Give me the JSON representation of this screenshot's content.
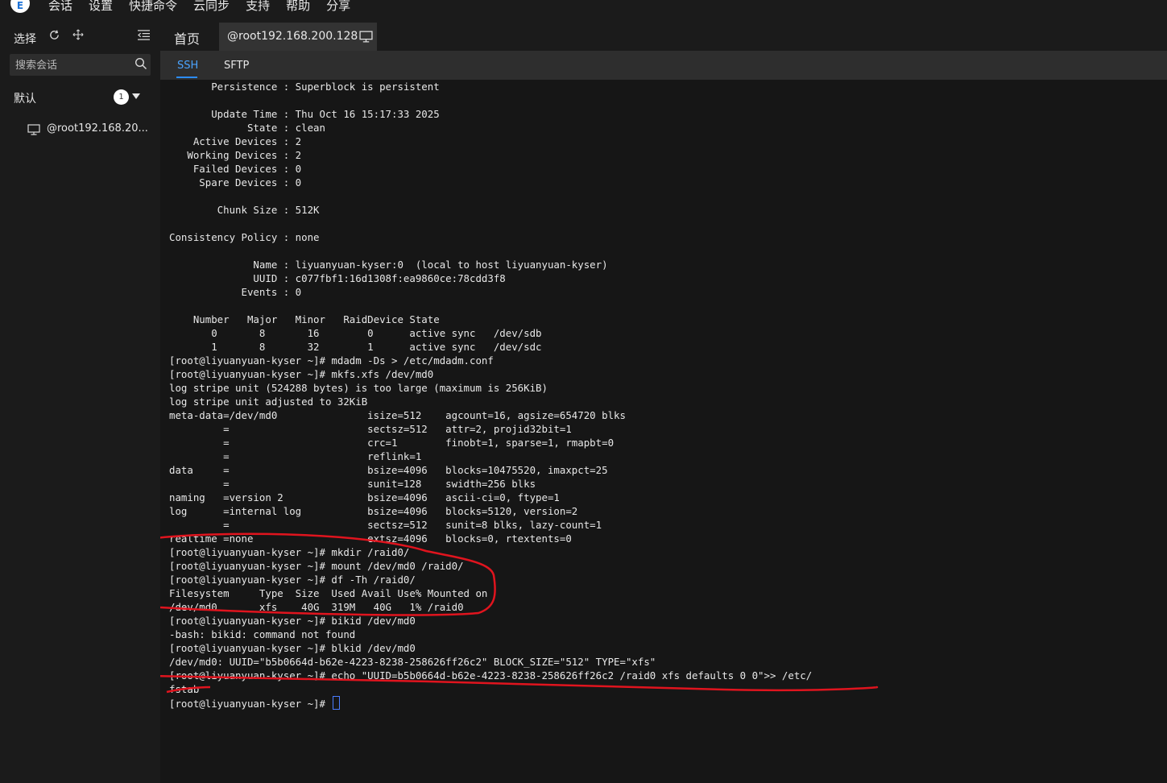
{
  "menubar": {
    "logo_text": "E",
    "items": [
      "会话",
      "设置",
      "快捷命令",
      "云同步",
      "支持",
      "帮助",
      "分享"
    ]
  },
  "sidebar": {
    "select_label": "选择",
    "search_placeholder": "搜索会话",
    "group": {
      "name": "默认",
      "count": "1"
    },
    "sessions": [
      "@root192.168.20..."
    ]
  },
  "tabs": {
    "home": "首页",
    "active": "@root192.168.200.128"
  },
  "subtabs": [
    "SSH",
    "SFTP"
  ],
  "terminal": {
    "lines": [
      "       Persistence : Superblock is persistent",
      "",
      "       Update Time : Thu Oct 16 15:17:33 2025",
      "             State : clean",
      "    Active Devices : 2",
      "   Working Devices : 2",
      "    Failed Devices : 0",
      "     Spare Devices : 0",
      "",
      "        Chunk Size : 512K",
      "",
      "Consistency Policy : none",
      "",
      "              Name : liyuanyuan-kyser:0  (local to host liyuanyuan-kyser)",
      "              UUID : c077fbf1:16d1308f:ea9860ce:78cdd3f8",
      "            Events : 0",
      "",
      "    Number   Major   Minor   RaidDevice State",
      "       0       8       16        0      active sync   /dev/sdb",
      "       1       8       32        1      active sync   /dev/sdc",
      "[root@liyuanyuan-kyser ~]# mdadm -Ds > /etc/mdadm.conf",
      "[root@liyuanyuan-kyser ~]# mkfs.xfs /dev/md0",
      "log stripe unit (524288 bytes) is too large (maximum is 256KiB)",
      "log stripe unit adjusted to 32KiB",
      "meta-data=/dev/md0               isize=512    agcount=16, agsize=654720 blks",
      "         =                       sectsz=512   attr=2, projid32bit=1",
      "         =                       crc=1        finobt=1, sparse=1, rmapbt=0",
      "         =                       reflink=1",
      "data     =                       bsize=4096   blocks=10475520, imaxpct=25",
      "         =                       sunit=128    swidth=256 blks",
      "naming   =version 2              bsize=4096   ascii-ci=0, ftype=1",
      "log      =internal log           bsize=4096   blocks=5120, version=2",
      "         =                       sectsz=512   sunit=8 blks, lazy-count=1",
      "realtime =none                   extsz=4096   blocks=0, rtextents=0",
      "[root@liyuanyuan-kyser ~]# mkdir /raid0/",
      "[root@liyuanyuan-kyser ~]# mount /dev/md0 /raid0/",
      "[root@liyuanyuan-kyser ~]# df -Th /raid0/",
      "Filesystem     Type  Size  Used Avail Use% Mounted on",
      "/dev/md0       xfs    40G  319M   40G   1% /raid0",
      "[root@liyuanyuan-kyser ~]# bikid /dev/md0",
      "-bash: bikid: command not found",
      "[root@liyuanyuan-kyser ~]# blkid /dev/md0",
      "/dev/md0: UUID=\"b5b0664d-b62e-4223-8238-258626ff26c2\" BLOCK_SIZE=\"512\" TYPE=\"xfs\"",
      "[root@liyuanyuan-kyser ~]# echo \"UUID=b5b0664d-b62e-4223-8238-258626ff26c2 /raid0 xfs defaults 0 0\">> /etc/",
      "fstab",
      "[root@liyuanyuan-kyser ~]# "
    ]
  },
  "colors": {
    "accent": "#2b8cff",
    "annotation": "#e0141e",
    "terminal_bg": "#161616"
  }
}
